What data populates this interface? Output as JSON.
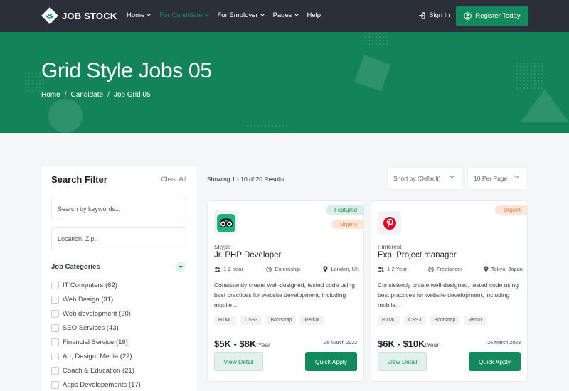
{
  "brand": {
    "name": "JOB STOCK",
    "accent": "#138a5e",
    "nav_bg": "#2a2f38",
    "hero_bg": "#13835a"
  },
  "nav": {
    "items": [
      {
        "label": "Home",
        "dropdown": true
      },
      {
        "label": "For Candidate",
        "dropdown": true,
        "active": true
      },
      {
        "label": "For Employer",
        "dropdown": true
      },
      {
        "label": "Pages",
        "dropdown": true
      },
      {
        "label": "Help",
        "dropdown": false
      }
    ],
    "signin": "Sign In",
    "register": "Register Today"
  },
  "hero": {
    "title": "Grid Style Jobs 05",
    "breadcrumb": [
      "Home",
      "Candidate",
      "Job Grid 05"
    ]
  },
  "filter": {
    "title": "Search Filter",
    "clear": "Clear All",
    "keyword_placeholder": "Search by keywords...",
    "location_placeholder": "Location, Zip..",
    "categories_title": "Job Categories",
    "categories": [
      "IT Computers (62)",
      "Web Design (31)",
      "Web development (20)",
      "SEO Services (43)",
      "Financial Service (16)",
      "Art, Design, Media (22)",
      "Coach & Education (21)",
      "Apps Developements (17)"
    ]
  },
  "results": {
    "showing": "Showing 1 - 10 of 20 Results",
    "sort": "Short by (Default)",
    "per_page": "10 Per Page"
  },
  "jobs": [
    {
      "badges": [
        "Featured",
        "Urgent"
      ],
      "logo_icon": "tripadvisor-owl-icon",
      "company": "Skype",
      "title": "Jr. PHP Developer",
      "experience": "1-2 Year",
      "type": "Enternship",
      "location": "London, UK",
      "description": "Consistently create well-designed, tested code using best practices for website development, including mobile...",
      "tags": [
        "HTML",
        "CSS3",
        "Bootstrap",
        "Redux"
      ],
      "salary": "$5K - $8K",
      "salary_period": "\\Year",
      "date": "26 March 2023",
      "detail_label": "View Detail",
      "apply_label": "Quick Apply"
    },
    {
      "badges": [
        "Urgent"
      ],
      "logo_icon": "pinterest-icon",
      "company": "Pinterest",
      "title": "Exp. Project manager",
      "experience": "1-2 Year",
      "type": "Freelancer",
      "location": "Tokyo, Japan",
      "description": "Consistently create well-designed, tested code using best practices for website development, including mobile...",
      "tags": [
        "HTML",
        "CSS3",
        "Bootstrap",
        "Redux"
      ],
      "salary": "$6K - $10K",
      "salary_period": "\\Year",
      "date": "26 March 2023",
      "detail_label": "View Detail",
      "apply_label": "Quick Apply"
    }
  ]
}
